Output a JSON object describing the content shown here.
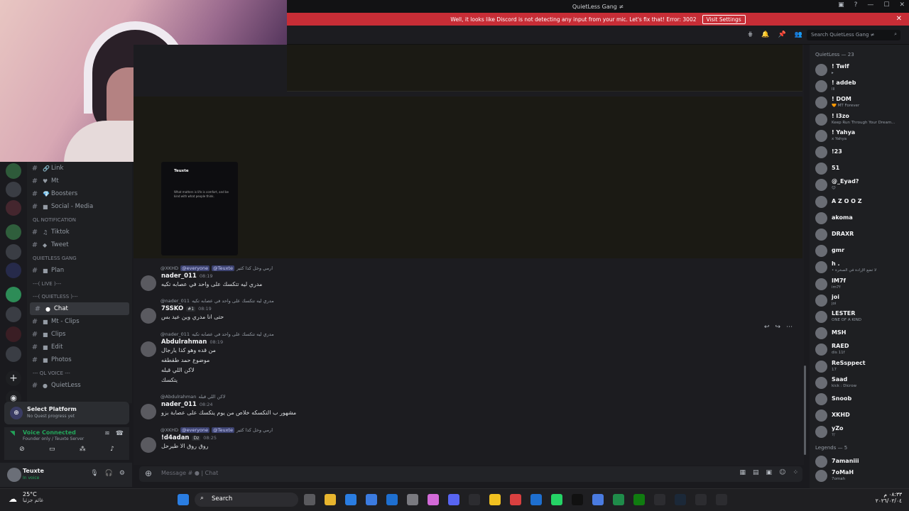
{
  "titlebar": {
    "title": "QuietLess Gang ≠"
  },
  "notice": {
    "text": "Well, it looks like Discord is not detecting any input from your mic. Let's fix that!  Error: 3002",
    "button": "Visit Settings",
    "close": "✕"
  },
  "header": {
    "search_placeholder": "Search QuietLess Gang ≠"
  },
  "channels": {
    "items_top": [
      {
        "name": "Link",
        "icon": "🔗"
      },
      {
        "name": "Mt",
        "icon": "♥"
      },
      {
        "name": "Boosters",
        "icon": "💎"
      },
      {
        "name": "Social - Media",
        "icon": "■"
      }
    ],
    "cat_notification": "QL NOTIFICATION",
    "items_notif": [
      {
        "name": "Tiktok",
        "icon": "♫"
      },
      {
        "name": "Tweet",
        "icon": "◆"
      }
    ],
    "cat_gang": "QUIETLESS GANG",
    "items_gang": [
      {
        "name": "Plan",
        "icon": "■"
      }
    ],
    "cat_live": "---( LIVE )---",
    "cat_quietless": "---( QUIETLESS )---",
    "items_quietless": [
      {
        "name": "Chat",
        "icon": "●"
      },
      {
        "name": "Mt - Clips",
        "icon": "■"
      },
      {
        "name": "Clips",
        "icon": "■"
      },
      {
        "name": "Edit",
        "icon": "■"
      },
      {
        "name": "Photos",
        "icon": "■"
      }
    ],
    "cat_voice": "--- QL VOICE ---",
    "items_voice": [
      {
        "name": "QuietLess",
        "icon": "●"
      }
    ]
  },
  "quest": {
    "title": "Select Platform",
    "sub": "No Quest progress yet"
  },
  "voice": {
    "status": "Voice Connected",
    "sub": "Founder only / Teuxte Server"
  },
  "user": {
    "name": "Teuxte",
    "status": "In voice"
  },
  "embed_phone": {
    "title": "Teuxte",
    "text": "What matters is life is comfort, and be kind with what people think."
  },
  "messages": [
    {
      "reply_user": "@XKHD",
      "reply_mentions": [
        "@everyone",
        "@Teuxte"
      ],
      "reply_text": "ارمي وخل كذا كثير",
      "user": "nader_011",
      "time": "08:19",
      "lines": [
        "مدري ليه تتكسك على واحد في عصابه تكيه"
      ]
    },
    {
      "reply_user": "@nader_011",
      "reply_text": "مدري ليه تتكسك على واحد في عصابه تكيه",
      "user": "7SSKO",
      "tag": "#1",
      "time": "08:19",
      "lines": [
        "حتى انا مدري وين عيد بس"
      ]
    },
    {
      "reply_user": "@nader_011",
      "reply_text": "مدري ليه تتكسك على واحد في عصابه تكيه",
      "user": "Abdulrahman",
      "time": "08:19",
      "lines": [
        "من قده وهو كذا يارجال",
        "موضوع حمد طقطقه",
        "لاكن اللي قبله",
        "يتكسك"
      ]
    },
    {
      "reply_user": "@Abdulrahman",
      "reply_text": "لاكن اللي قبله",
      "user": "nader_011",
      "time": "08:24",
      "lines": [
        "مشهور ب التكسكه خلاص من يوم يتكسك على عصابة بزو"
      ]
    },
    {
      "reply_user": "@XKHD",
      "reply_mentions": [
        "@everyone",
        "@Teuxte"
      ],
      "reply_text": "ارمي وخل كذا كثير",
      "user": "!d4adan",
      "tag": "Dz",
      "time": "08:25",
      "lines": [
        "روق روق الا طيرحل"
      ]
    }
  ],
  "composer": {
    "placeholder": "Message # ● | Chat"
  },
  "members": {
    "cat1": "QuietLess — 23",
    "list1": [
      {
        "name": "! Twlf",
        "sub": "▸"
      },
      {
        "name": "! addeb",
        "sub": "lll"
      },
      {
        "name": "! DOM",
        "sub": "🧡 MT Forever"
      },
      {
        "name": "! l3zo",
        "sub": "Keep Run Through Your Dream..."
      },
      {
        "name": "! Yahya",
        "sub": "x Yahya"
      },
      {
        "name": "!23",
        "sub": ""
      },
      {
        "name": "51",
        "sub": ""
      },
      {
        "name": "@_Eyad?",
        "sub": "😊"
      },
      {
        "name": "A Z O O Z",
        "sub": ""
      },
      {
        "name": "akoma",
        "sub": ""
      },
      {
        "name": "DRAXR",
        "sub": ""
      },
      {
        "name": "gmr",
        "sub": ""
      },
      {
        "name": "h .",
        "sub": "• لا تضع الإرادة في الصخرة"
      },
      {
        "name": "IM7f",
        "sub": "im7f"
      },
      {
        "name": "joi",
        "sub": "joi"
      },
      {
        "name": "LESTER",
        "sub": "ONE OF A KIND"
      },
      {
        "name": "MSH",
        "sub": ""
      },
      {
        "name": "RAED",
        "sub": "dis 11f"
      },
      {
        "name": "ReSsppect",
        "sub": "17"
      },
      {
        "name": "Saad",
        "sub": "kick : Dicrow"
      },
      {
        "name": "Snoob",
        "sub": ""
      },
      {
        "name": "XKHD",
        "sub": ""
      },
      {
        "name": "yZo",
        "sub": "?/"
      }
    ],
    "cat2": "Legends — 5",
    "list2": [
      {
        "name": "7amaniii",
        "sub": ""
      },
      {
        "name": "7oMaH",
        "sub": "7omah"
      }
    ]
  },
  "taskbar": {
    "temp": "25°C",
    "weather": "غائم جزئيا",
    "search": "Search",
    "time": "٠٨:٣٣ م",
    "date": "٢٠٢٦/٠٢/٠٤"
  }
}
